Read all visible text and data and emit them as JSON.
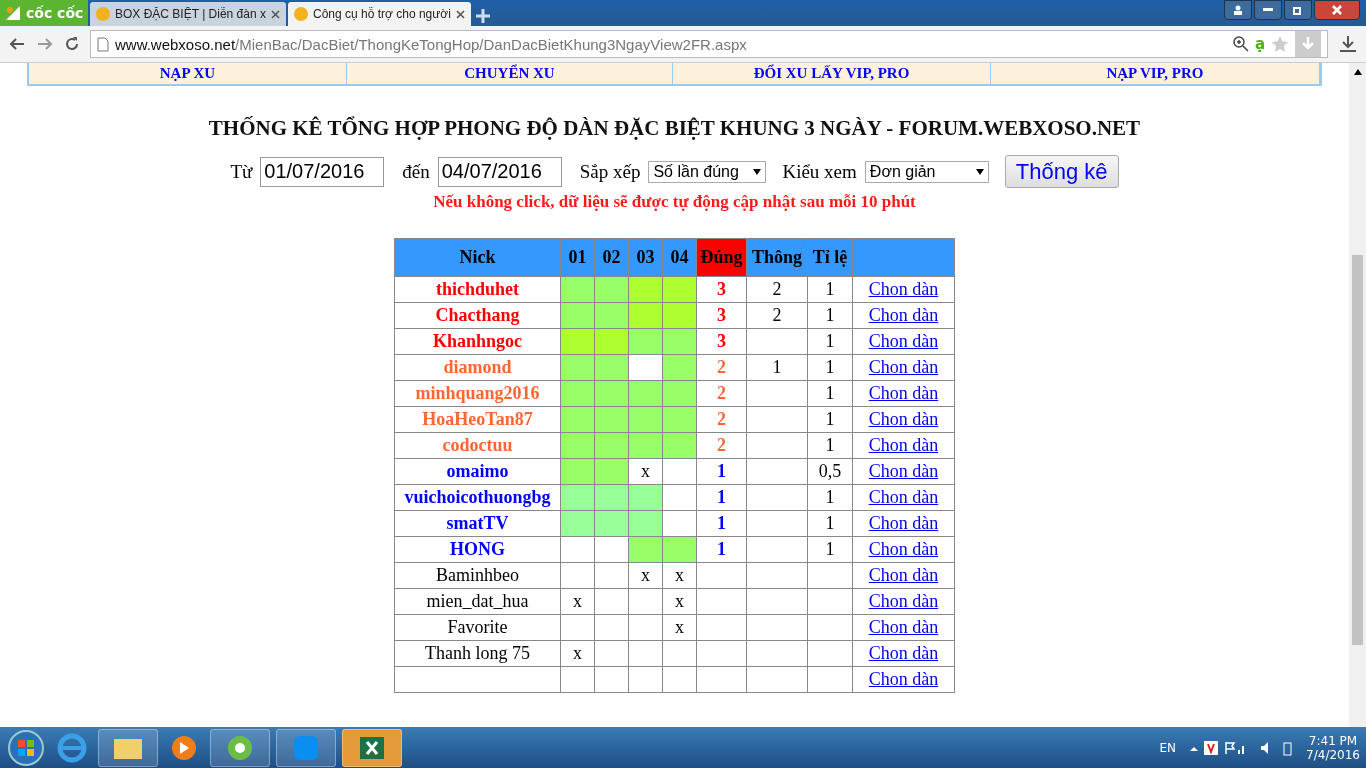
{
  "browser": {
    "brand": "cốc cốc",
    "tabs": [
      {
        "title": "BOX ĐẶC BIỆT | Diễn đàn x",
        "selected": false
      },
      {
        "title": "Công cụ hỗ trợ cho người",
        "selected": true
      }
    ],
    "url_host": "www.webxoso.net",
    "url_path": "/MienBac/DacBiet/ThongKeTongHop/DanDacBietKhung3NgayView2FR.aspx",
    "extension": "ạ"
  },
  "nav": [
    "NẠP XU",
    "CHUYỂN XU",
    "ĐỔI XU LẤY VIP, PRO",
    "NẠP VIP, PRO"
  ],
  "title": "THỐNG KÊ TỔNG HỢP PHONG ĐỘ DÀN ĐẶC BIỆT KHUNG 3 NGÀY - FORUM.WEBXOSO.NET",
  "form": {
    "from_label": "Từ",
    "from_value": "01/07/2016",
    "to_label": "đến",
    "to_value": "04/07/2016",
    "sort_label": "Sắp xếp",
    "sort_value": "Số lần đúng",
    "view_label": "Kiểu xem",
    "view_value": "Đơn giản",
    "submit": "Thống kê"
  },
  "notice": "Nếu không click, dữ liệu sẽ được tự động cập nhật sau mỗi 10 phút",
  "table": {
    "columns": [
      "Nick",
      "01",
      "02",
      "03",
      "04",
      "Đúng",
      "Thông",
      "Tỉ lệ"
    ],
    "rows": [
      {
        "cells": [
          {
            "kind": "nick",
            "text": "thichduhet",
            "color": "#ff0000"
          },
          {
            "kind": "hit",
            "color": "#99ff66"
          },
          {
            "kind": "hit",
            "color": "#99ff66"
          },
          {
            "kind": "hit",
            "color": "#adff2f"
          },
          {
            "kind": "hit",
            "color": "#adff2f"
          },
          {
            "kind": "count",
            "text": "3",
            "color": "#ff0000"
          },
          {
            "kind": "number",
            "text": "2"
          },
          {
            "kind": "number",
            "text": "1"
          },
          {
            "kind": "link",
            "text": "Chon dàn"
          }
        ]
      },
      {
        "cells": [
          {
            "kind": "nick",
            "text": "Chacthang",
            "color": "#ff0000"
          },
          {
            "kind": "hit",
            "color": "#99ff66"
          },
          {
            "kind": "hit",
            "color": "#99ff66"
          },
          {
            "kind": "hit",
            "color": "#adff2f"
          },
          {
            "kind": "hit",
            "color": "#adff2f"
          },
          {
            "kind": "count",
            "text": "3",
            "color": "#ff0000"
          },
          {
            "kind": "number",
            "text": "2"
          },
          {
            "kind": "number",
            "text": "1"
          },
          {
            "kind": "link",
            "text": "Chon dàn"
          }
        ]
      },
      {
        "cells": [
          {
            "kind": "nick",
            "text": "Khanhngoc",
            "color": "#ff0000"
          },
          {
            "kind": "hit",
            "color": "#adff2f"
          },
          {
            "kind": "hit",
            "color": "#adff2f"
          },
          {
            "kind": "hit",
            "color": "#99ff66"
          },
          {
            "kind": "hit",
            "color": "#99ff66"
          },
          {
            "kind": "count",
            "text": "3",
            "color": "#ff0000"
          },
          {
            "kind": "blank"
          },
          {
            "kind": "number",
            "text": "1"
          },
          {
            "kind": "link",
            "text": "Chon dàn"
          }
        ]
      },
      {
        "cells": [
          {
            "kind": "nick",
            "text": "diamond",
            "color": "#ff6633"
          },
          {
            "kind": "hit",
            "color": "#99ff66"
          },
          {
            "kind": "hit",
            "color": "#99ff66"
          },
          {
            "kind": "blank"
          },
          {
            "kind": "hit",
            "color": "#99ff66"
          },
          {
            "kind": "count",
            "text": "2",
            "color": "#ff6633"
          },
          {
            "kind": "number",
            "text": "1"
          },
          {
            "kind": "number",
            "text": "1"
          },
          {
            "kind": "link",
            "text": "Chon dàn"
          }
        ]
      },
      {
        "cells": [
          {
            "kind": "nick",
            "text": "minhquang2016",
            "color": "#ff6633"
          },
          {
            "kind": "hit",
            "color": "#99ff66"
          },
          {
            "kind": "hit",
            "color": "#99ff66"
          },
          {
            "kind": "hit",
            "color": "#99ff66"
          },
          {
            "kind": "hit",
            "color": "#99ff66"
          },
          {
            "kind": "count",
            "text": "2",
            "color": "#ff6633"
          },
          {
            "kind": "blank"
          },
          {
            "kind": "number",
            "text": "1"
          },
          {
            "kind": "link",
            "text": "Chon dàn"
          }
        ]
      },
      {
        "cells": [
          {
            "kind": "nick",
            "text": "HoaHeoTan87",
            "color": "#ff6633"
          },
          {
            "kind": "hit",
            "color": "#99ff66"
          },
          {
            "kind": "hit",
            "color": "#99ff66"
          },
          {
            "kind": "hit",
            "color": "#99ff66"
          },
          {
            "kind": "hit",
            "color": "#99ff66"
          },
          {
            "kind": "count",
            "text": "2",
            "color": "#ff6633"
          },
          {
            "kind": "blank"
          },
          {
            "kind": "number",
            "text": "1"
          },
          {
            "kind": "link",
            "text": "Chon dàn"
          }
        ]
      },
      {
        "cells": [
          {
            "kind": "nick",
            "text": "codoctuu",
            "color": "#ff6633"
          },
          {
            "kind": "hit",
            "color": "#99ff66"
          },
          {
            "kind": "hit",
            "color": "#99ff66"
          },
          {
            "kind": "hit",
            "color": "#99ff66"
          },
          {
            "kind": "hit",
            "color": "#99ff66"
          },
          {
            "kind": "count",
            "text": "2",
            "color": "#ff6633"
          },
          {
            "kind": "blank"
          },
          {
            "kind": "number",
            "text": "1"
          },
          {
            "kind": "link",
            "text": "Chon dàn"
          }
        ]
      },
      {
        "cells": [
          {
            "kind": "nick",
            "text": "omaimo",
            "color": "#0000ff"
          },
          {
            "kind": "hit",
            "color": "#99ff66"
          },
          {
            "kind": "hit",
            "color": "#99ff66"
          },
          {
            "kind": "miss",
            "text": "x"
          },
          {
            "kind": "blank"
          },
          {
            "kind": "count",
            "text": "1",
            "color": "#0000ff"
          },
          {
            "kind": "blank"
          },
          {
            "kind": "number",
            "text": "0,5"
          },
          {
            "kind": "link",
            "text": "Chon dàn"
          }
        ]
      },
      {
        "cells": [
          {
            "kind": "nick",
            "text": "vuichoicothuongbg",
            "color": "#0000ff"
          },
          {
            "kind": "hit",
            "color": "#99ff99"
          },
          {
            "kind": "hit",
            "color": "#99ff99"
          },
          {
            "kind": "hit",
            "color": "#99ff99"
          },
          {
            "kind": "blank"
          },
          {
            "kind": "count",
            "text": "1",
            "color": "#0000ff"
          },
          {
            "kind": "blank"
          },
          {
            "kind": "number",
            "text": "1"
          },
          {
            "kind": "link",
            "text": "Chon dàn"
          }
        ]
      },
      {
        "cells": [
          {
            "kind": "nick",
            "text": "smatTV",
            "color": "#0000ff"
          },
          {
            "kind": "hit",
            "color": "#99ff99"
          },
          {
            "kind": "hit",
            "color": "#99ff99"
          },
          {
            "kind": "hit",
            "color": "#99ff99"
          },
          {
            "kind": "blank"
          },
          {
            "kind": "count",
            "text": "1",
            "color": "#0000ff"
          },
          {
            "kind": "blank"
          },
          {
            "kind": "number",
            "text": "1"
          },
          {
            "kind": "link",
            "text": "Chon dàn"
          }
        ]
      },
      {
        "cells": [
          {
            "kind": "nick",
            "text": "HONG",
            "color": "#0000ff"
          },
          {
            "kind": "blank"
          },
          {
            "kind": "blank"
          },
          {
            "kind": "hit",
            "color": "#99ff66"
          },
          {
            "kind": "hit",
            "color": "#99ff66"
          },
          {
            "kind": "count",
            "text": "1",
            "color": "#0000ff"
          },
          {
            "kind": "blank"
          },
          {
            "kind": "number",
            "text": "1"
          },
          {
            "kind": "link",
            "text": "Chon dàn"
          }
        ]
      },
      {
        "cells": [
          {
            "kind": "nick",
            "text": "Baminhbeo",
            "color": "#000000"
          },
          {
            "kind": "blank"
          },
          {
            "kind": "blank"
          },
          {
            "kind": "miss",
            "text": "x"
          },
          {
            "kind": "miss",
            "text": "x"
          },
          {
            "kind": "blank"
          },
          {
            "kind": "blank"
          },
          {
            "kind": "blank"
          },
          {
            "kind": "link",
            "text": "Chon dàn"
          }
        ]
      },
      {
        "cells": [
          {
            "kind": "nick",
            "text": "mien_dat_hua",
            "color": "#000000"
          },
          {
            "kind": "miss",
            "text": "x"
          },
          {
            "kind": "blank"
          },
          {
            "kind": "blank"
          },
          {
            "kind": "miss",
            "text": "x"
          },
          {
            "kind": "blank"
          },
          {
            "kind": "blank"
          },
          {
            "kind": "blank"
          },
          {
            "kind": "link",
            "text": "Chon dàn"
          }
        ]
      },
      {
        "cells": [
          {
            "kind": "nick",
            "text": "Favorite",
            "color": "#000000"
          },
          {
            "kind": "blank"
          },
          {
            "kind": "blank"
          },
          {
            "kind": "blank"
          },
          {
            "kind": "miss",
            "text": "x"
          },
          {
            "kind": "blank"
          },
          {
            "kind": "blank"
          },
          {
            "kind": "blank"
          },
          {
            "kind": "link",
            "text": "Chon dàn"
          }
        ]
      },
      {
        "cells": [
          {
            "kind": "nick",
            "text": "Thanh long 75",
            "color": "#000000"
          },
          {
            "kind": "miss",
            "text": "x"
          },
          {
            "kind": "blank"
          },
          {
            "kind": "blank"
          },
          {
            "kind": "blank"
          },
          {
            "kind": "blank"
          },
          {
            "kind": "blank"
          },
          {
            "kind": "blank"
          },
          {
            "kind": "link",
            "text": "Chon dàn"
          }
        ]
      },
      {
        "cells": [
          {
            "kind": "blank"
          },
          {
            "kind": "blank"
          },
          {
            "kind": "blank"
          },
          {
            "kind": "blank"
          },
          {
            "kind": "blank"
          },
          {
            "kind": "blank"
          },
          {
            "kind": "blank"
          },
          {
            "kind": "blank"
          },
          {
            "kind": "link",
            "text": "Chon dàn"
          }
        ]
      }
    ]
  },
  "taskbar": {
    "language": "EN",
    "time": "7:41 PM",
    "date": "7/4/2016"
  }
}
